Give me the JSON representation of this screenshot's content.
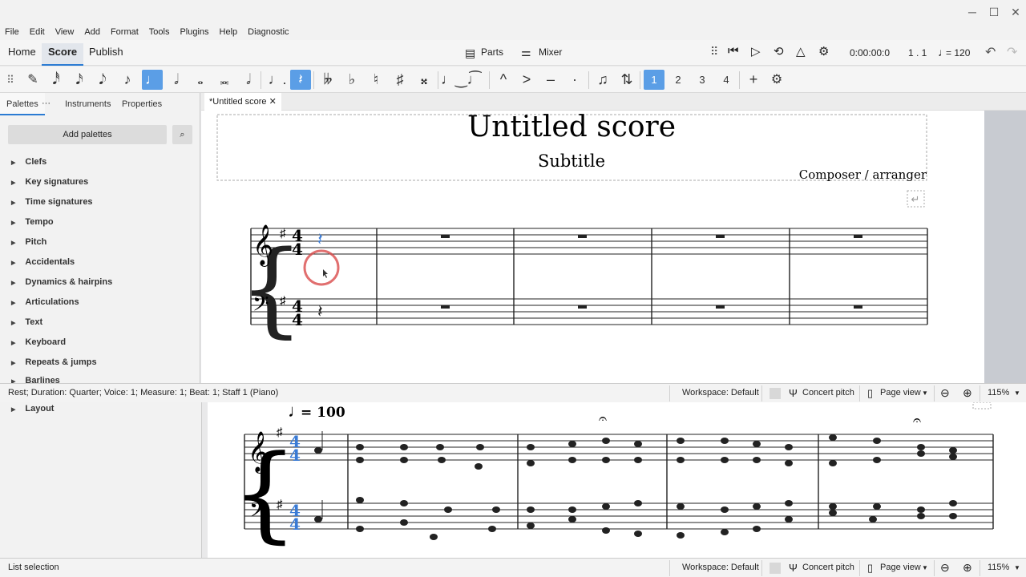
{
  "window": {
    "controls": [
      "─",
      "☐",
      "✕"
    ]
  },
  "menu": [
    "File",
    "Edit",
    "View",
    "Add",
    "Format",
    "Tools",
    "Plugins",
    "Help",
    "Diagnostic"
  ],
  "tabs": [
    "Home",
    "Score",
    "Publish"
  ],
  "header": {
    "parts": "Parts",
    "mixer": "Mixer",
    "time": "0:00:00:0",
    "position": "1 . 1",
    "tempo": "= 120"
  },
  "toolbar": {
    "notes": [
      "𝅘𝅥𝅰",
      "𝅘𝅥𝅯",
      "𝅘𝅥𝅮",
      "♪",
      "♩",
      "𝅗𝅥",
      "𝅝",
      "𝅜",
      "𝅗𝅥"
    ],
    "accidentals": [
      "𝄫",
      "♭",
      "♮",
      "♯",
      "𝄪"
    ],
    "articulations": [
      "^",
      ">",
      "–",
      "·"
    ],
    "voices": [
      "1",
      "2",
      "3",
      "4"
    ]
  },
  "panel": {
    "tabs": [
      "Palettes",
      "Instruments",
      "Properties"
    ],
    "add": "Add palettes",
    "items": [
      "Clefs",
      "Key signatures",
      "Time signatures",
      "Tempo",
      "Pitch",
      "Accidentals",
      "Dynamics & hairpins",
      "Articulations",
      "Text",
      "Keyboard",
      "Repeats & jumps",
      "Barlines"
    ],
    "lower_item": "Layout"
  },
  "score": {
    "tab": "*Untitled score",
    "title": "Untitled score",
    "subtitle": "Subtitle",
    "composer": "Composer / arranger",
    "lower_tempo": "= 100"
  },
  "status": {
    "selection": "Rest; Duration: Quarter; Voice: 1; Measure: 1; Beat: 1; Staff 1 (Piano)",
    "workspace": "Workspace: Default",
    "concert": "Concert pitch",
    "view": "Page view",
    "zoom": "115%",
    "lower_selection": "List selection"
  }
}
